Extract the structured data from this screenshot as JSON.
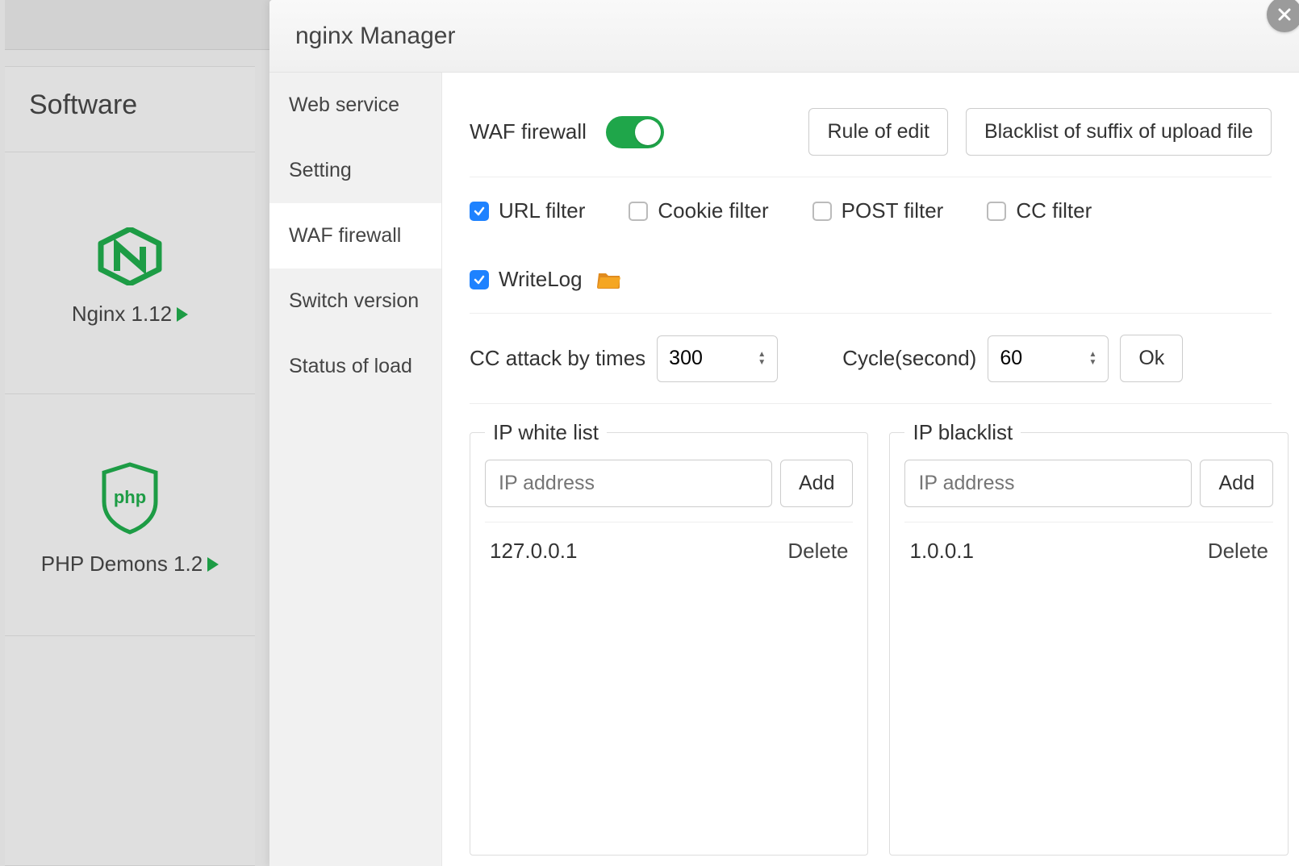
{
  "background": {
    "sidebar_header": "Software",
    "tiles": [
      {
        "label": "Nginx 1.12"
      },
      {
        "label": "PHP Demons 1.2"
      }
    ]
  },
  "modal": {
    "title": "nginx Manager",
    "tabs": [
      {
        "label": "Web service"
      },
      {
        "label": "Setting"
      },
      {
        "label": "WAF firewall"
      },
      {
        "label": "Switch version"
      },
      {
        "label": "Status of load"
      }
    ],
    "active_tab_index": 2,
    "waf": {
      "label": "WAF firewall",
      "toggle_on": true,
      "rule_button": "Rule of edit",
      "blacklist_suffix_button": "Blacklist of suffix of upload file",
      "filters": [
        {
          "label": "URL filter",
          "checked": true
        },
        {
          "label": "Cookie filter",
          "checked": false
        },
        {
          "label": "POST filter",
          "checked": false
        },
        {
          "label": "CC filter",
          "checked": false
        },
        {
          "label": "WriteLog",
          "checked": true,
          "folder_icon": true
        }
      ],
      "cc": {
        "times_label": "CC attack by times",
        "times_value": "300",
        "cycle_label": "Cycle(second)",
        "cycle_value": "60",
        "ok_label": "Ok"
      },
      "lists": {
        "white": {
          "legend": "IP white list",
          "placeholder": "IP address",
          "add_label": "Add",
          "items": [
            {
              "ip": "127.0.0.1",
              "delete_label": "Delete"
            }
          ]
        },
        "black": {
          "legend": "IP blacklist",
          "placeholder": "IP address",
          "add_label": "Add",
          "items": [
            {
              "ip": "1.0.0.1",
              "delete_label": "Delete"
            }
          ]
        }
      }
    }
  }
}
